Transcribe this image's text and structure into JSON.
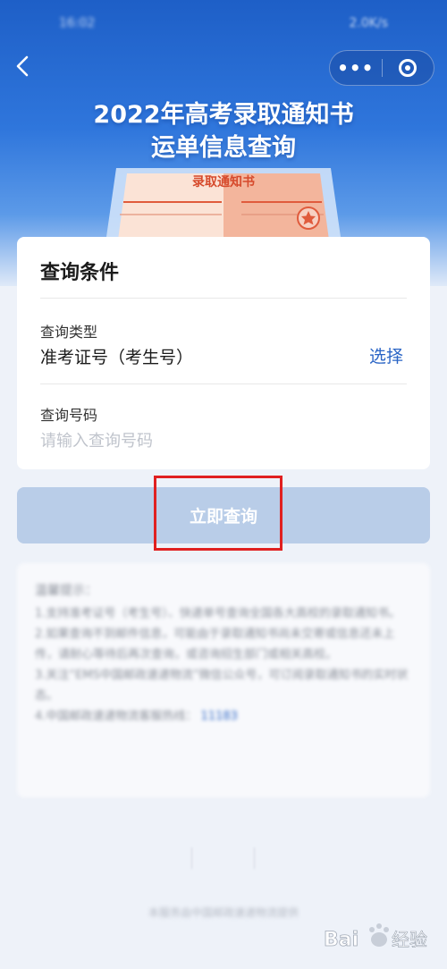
{
  "status_bar": {
    "time": "16:02",
    "network": "2.0K/s"
  },
  "nav": {
    "back_icon": "chevron-left-icon",
    "more_label": "•••",
    "close_icon": "target-icon"
  },
  "hero": {
    "title_line1": "2022年高考录取通知书",
    "title_line2": "运单信息查询",
    "letter_text": "录取通知书"
  },
  "form": {
    "title": "查询条件",
    "type_label": "查询类型",
    "type_value": "准考证号（考生号）",
    "select_label": "选择",
    "number_label": "查询号码",
    "number_placeholder": "请输入查询号码",
    "number_value": ""
  },
  "submit": {
    "label": "立即查询"
  },
  "tips": {
    "title": "温馨提示：",
    "items": [
      "1.支持准考证号（考生号）、快递单号查询全国各大高校的录取通知书。",
      "2.如果查询不到邮件信息，可能由于录取通知书尚未交寄或信息还未上传，请耐心等待后再次查询，或咨询招生部门或相关高校。",
      "3.关注“EMS中国邮政速递物流”微信公众号，可订阅录取通知书的实时状态。",
      "4.中国邮政速递物流客服热线："
    ],
    "hotline": "11183"
  },
  "footer": {
    "note": "本服务由中国邮政速递物流提供"
  },
  "colors": {
    "brand_blue": "#2a64c5",
    "button_disabled": "#b9cde8",
    "highlight_red": "#e02020"
  }
}
